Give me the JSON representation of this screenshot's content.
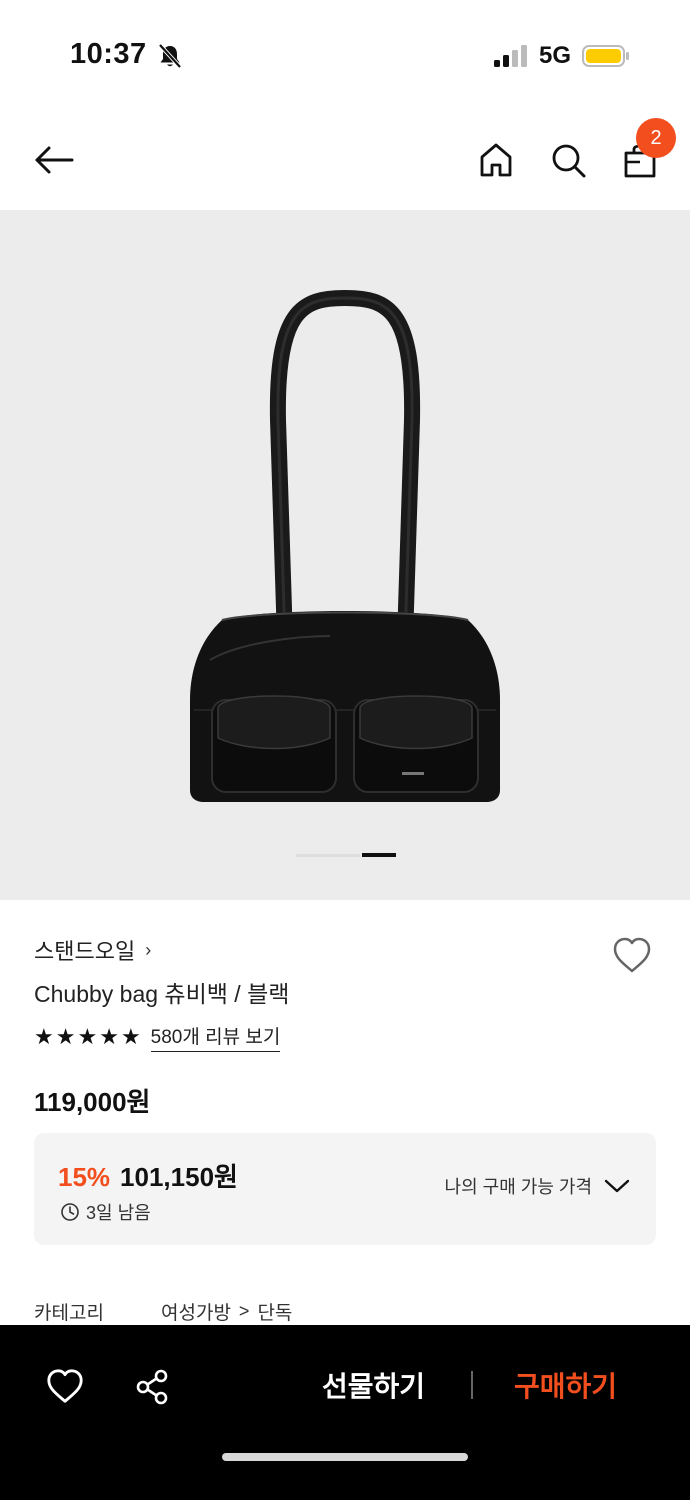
{
  "status_bar": {
    "time": "10:37",
    "network": "5G"
  },
  "nav": {
    "cart_count": "2"
  },
  "product": {
    "brand": "스탠드오일",
    "brand_chevron": "›",
    "title": "Chubby bag 츄비백 / 블랙",
    "rating_stars": 5,
    "review_link": "580개 리뷰 보기",
    "list_price": "119,000원",
    "discount_rate": "15%",
    "sale_price": "101,150원",
    "remaining": "3일 남음",
    "my_price_label": "나의 구매 가능 가격",
    "category_label": "카테고리",
    "category_path": [
      "여성가방",
      "단독"
    ],
    "category_separator": ">"
  },
  "gallery": {
    "current_page": 2,
    "total_pages": 2
  },
  "bottom_bar": {
    "gift_label": "선물하기",
    "buy_label": "구매하기"
  },
  "colors": {
    "accent": "#f24e1e",
    "hero_bg": "#ececec",
    "bottom_bar_bg": "#000000",
    "battery": "#ffcc00"
  },
  "icons": [
    "bell-slash-icon",
    "signal-icon",
    "battery-icon",
    "back-arrow-icon",
    "home-icon",
    "search-icon",
    "shopping-bag-icon",
    "heart-icon",
    "star-icon",
    "clock-icon",
    "chevron-down-icon",
    "share-icon"
  ]
}
